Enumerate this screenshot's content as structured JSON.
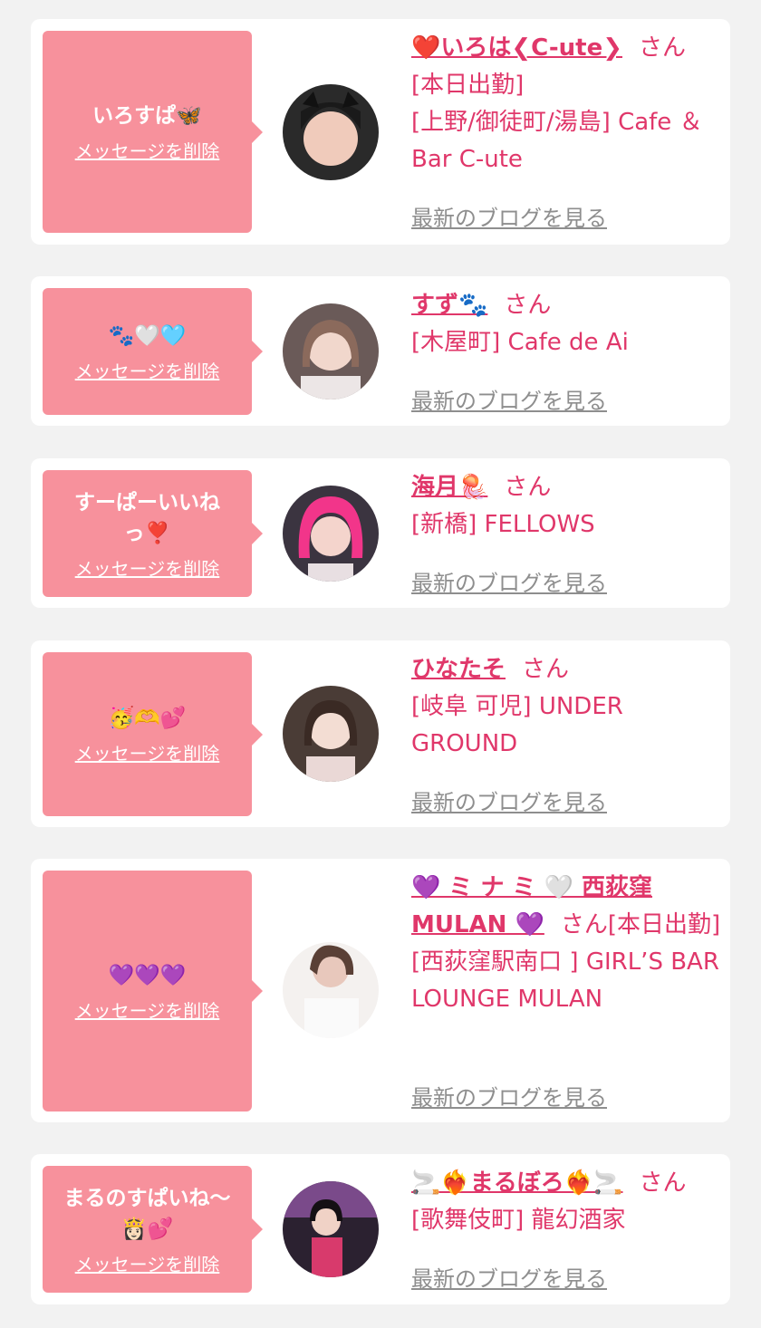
{
  "delete_label": "メッセージを削除",
  "san_label": "さん",
  "blog_label": "最新のブログを見る",
  "colors": {
    "background": "#f2f2f2",
    "bubble": "#f7919c",
    "accent": "#e0376a",
    "muted": "#8e8e8e"
  },
  "cards": [
    {
      "message": "いろすぱ🦋",
      "name": "❤️いろは❮C-ute❯",
      "lines": [
        "[本日出勤]",
        "[上野/御徒町/湯島] Cafe ＆Bar C-ute"
      ]
    },
    {
      "message": "🐾🤍🩵",
      "name": "すず🐾",
      "lines": [
        "[木屋町] Cafe de Ai"
      ]
    },
    {
      "message": "すーぱーいいねっ❣️",
      "name": "海月🪼",
      "lines": [
        "[新橋] FELLOWS"
      ]
    },
    {
      "message": "🥳🫶💕",
      "name": "ひなたそ",
      "lines": [
        "[岐阜 可児] UNDER GROUND"
      ]
    },
    {
      "message": "💜💜💜",
      "name": "💜 ミ ナ ミ 🤍 西荻窪 MULAN 💜",
      "lines": [
        "[本日出勤]",
        "[西荻窪駅南口 ] GIRL’S BAR LOUNGE MULAN"
      ]
    },
    {
      "message": "まるのすぱいね〜👸🏻💕",
      "name": "🚬❤️‍🔥まるぼろ❤️‍🔥🚬",
      "lines": [
        "[歌舞伎町] 龍幻酒家"
      ]
    }
  ]
}
